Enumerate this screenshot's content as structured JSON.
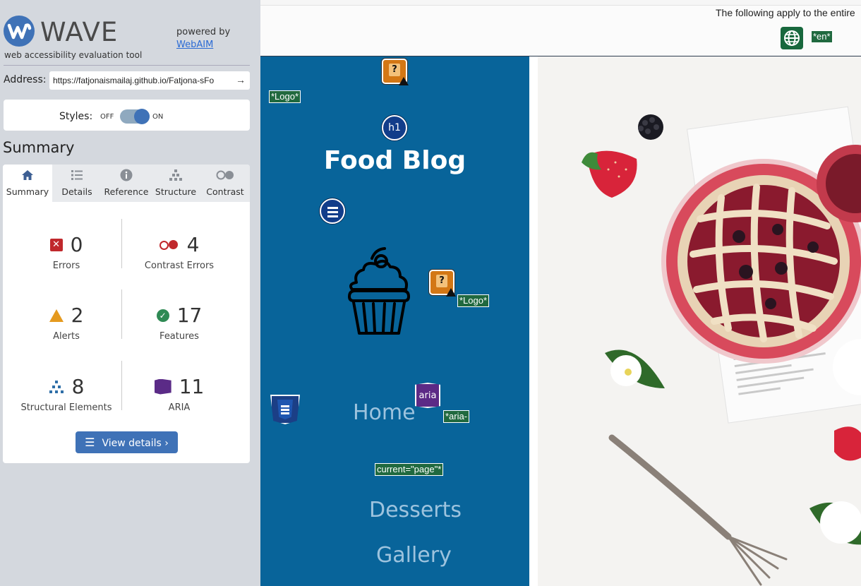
{
  "wave": {
    "title": "WAVE",
    "subtitle": "web accessibility evaluation tool",
    "powered_by": "powered by",
    "powered_link": "WebAIM"
  },
  "address": {
    "label": "Address:",
    "value": "https://fatjonaismailaj.github.io/Fatjona-sFo"
  },
  "styles": {
    "label": "Styles:",
    "off": "OFF",
    "on": "ON",
    "state": "on"
  },
  "summary_heading": "Summary",
  "tabs": [
    {
      "label": "Summary",
      "icon": "home-icon",
      "active": true
    },
    {
      "label": "Details",
      "icon": "list-icon",
      "active": false
    },
    {
      "label": "Reference",
      "icon": "info-icon",
      "active": false
    },
    {
      "label": "Structure",
      "icon": "structure-icon",
      "active": false
    },
    {
      "label": "Contrast",
      "icon": "contrast-icon",
      "active": false
    }
  ],
  "stats": {
    "errors": {
      "value": "0",
      "label": "Errors"
    },
    "contrast": {
      "value": "4",
      "label": "Contrast Errors"
    },
    "alerts": {
      "value": "2",
      "label": "Alerts"
    },
    "features": {
      "value": "17",
      "label": "Features"
    },
    "structural": {
      "value": "8",
      "label": "Structural Elements"
    },
    "aria": {
      "value": "11",
      "label": "ARIA"
    }
  },
  "view_details": "View details ›",
  "preview": {
    "lang_text": "The following apply to the entire",
    "lang_tag": "*en*",
    "logo_tag_1": "*Logo*",
    "logo_tag_2": "*Logo*",
    "h1_label": "h1",
    "blog_title": "Food Blog",
    "aria_label": "aria",
    "aria_tag_1": "*aria-",
    "aria_tag_2": "current=\"page\"*",
    "nav": [
      "Home",
      "Desserts",
      "Gallery"
    ]
  },
  "colors": {
    "wave_blue": "#3f72b7",
    "nav_blue": "#08649a",
    "tag_green": "#20693f",
    "error_red": "#c0282c",
    "alert_orange": "#e59a1f",
    "aria_purple": "#5c2a86"
  }
}
